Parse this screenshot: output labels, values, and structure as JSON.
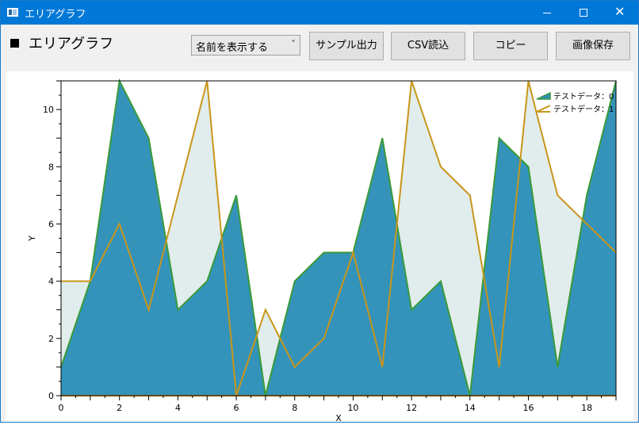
{
  "window": {
    "title": "エリアグラフ",
    "close_glyph": "✕"
  },
  "header": {
    "title": "エリアグラフ"
  },
  "controls": {
    "select_value": "名前を表示する",
    "chevron": "˅",
    "sample_output": "サンプル出力",
    "csv_read": "CSV読込",
    "copy": "コピー",
    "save_image": "画像保存"
  },
  "colors": {
    "area0": "#2e8fb8",
    "line0": "#3a9a3a",
    "area1": "#e1ecec",
    "line1": "#c8961a",
    "title_bar": "#0078d7"
  },
  "chart_data": {
    "type": "area",
    "x": [
      0,
      1,
      2,
      3,
      4,
      5,
      6,
      7,
      8,
      9,
      10,
      11,
      12,
      13,
      14,
      15,
      16,
      17,
      18,
      19
    ],
    "series": [
      {
        "name": "テストデータ：0",
        "values": [
          1,
          4,
          11,
          9,
          3,
          4,
          7,
          0,
          4,
          5,
          5,
          9,
          3,
          4,
          0,
          9,
          8,
          1,
          7,
          11
        ]
      },
      {
        "name": "テストデータ：1",
        "values": [
          4,
          4,
          6,
          3,
          7,
          11,
          0,
          3,
          1,
          2,
          5,
          1,
          11,
          8,
          7,
          1,
          11,
          7,
          6,
          5
        ]
      }
    ],
    "xlabel": "X",
    "ylabel": "Y",
    "xlim": [
      0,
      19
    ],
    "ylim": [
      0,
      11
    ],
    "xticks": [
      0,
      2,
      4,
      6,
      8,
      10,
      12,
      14,
      16,
      18
    ],
    "yticks": [
      0,
      2,
      4,
      6,
      8,
      10
    ],
    "legend": "top-right",
    "grid": false
  }
}
